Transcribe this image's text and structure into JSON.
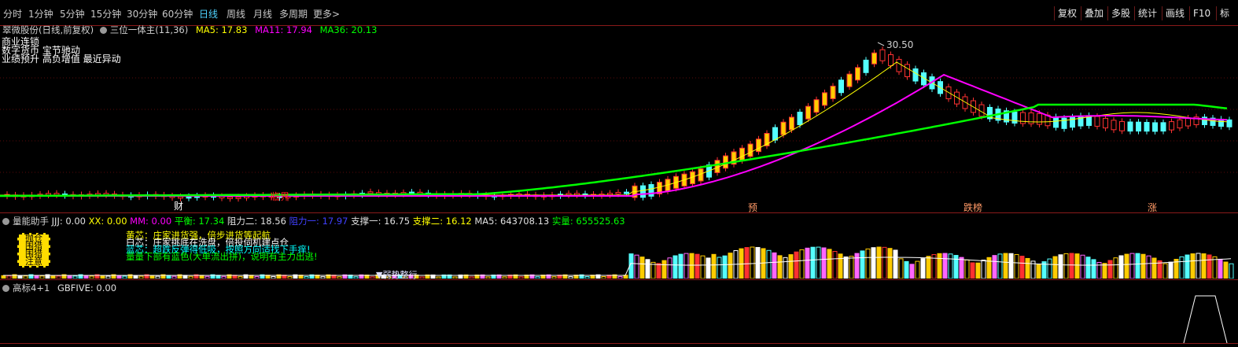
{
  "toolbar": {
    "periods": [
      "分时",
      "1分钟",
      "5分钟",
      "15分钟",
      "30分钟",
      "60分钟",
      "日线",
      "周线",
      "月线",
      "多周期",
      "更多"
    ],
    "active_period": "日线",
    "right_buttons": [
      "复权",
      "叠加",
      "多股",
      "统计",
      "画线",
      "F10",
      "标"
    ]
  },
  "main_panel": {
    "stock_title": "翠微股份(日线,前复权)",
    "indicator_name": "三位一体主(11,36)",
    "ma5": {
      "label": "MA5: 17.83",
      "color": "#ffff00"
    },
    "ma11": {
      "label": "MA11: 17.94",
      "color": "#ff00ff"
    },
    "ma36": {
      "label": "MA36: 20.13",
      "color": "#00ff00"
    },
    "concepts": [
      "商业连锁",
      "数字货币 宝节驰动",
      "业绩预升 高负增值 最近异动"
    ],
    "high_label": "30.50",
    "markers": [
      "财",
      "临界",
      "预",
      "跌榜",
      "涨"
    ]
  },
  "volume_panel": {
    "name": "量能助手",
    "stats": [
      {
        "text": "JJJ: 0.00",
        "color": "#e0e0e0"
      },
      {
        "text": "XX: 0.00",
        "color": "#ffff00"
      },
      {
        "text": "MM: 0.00",
        "color": "#ff00ff"
      },
      {
        "text": "平衡: 17.34",
        "color": "#00ff00"
      },
      {
        "text": "阻力二: 18.56",
        "color": "#e0e0e0"
      },
      {
        "text": "阻力一: 17.97",
        "color": "#4040ff"
      },
      {
        "text": "支撑一: 16.75",
        "color": "#e0e0e0"
      },
      {
        "text": "支撑二: 16.12",
        "color": "#ffff00"
      },
      {
        "text": "MA5: 643708.13",
        "color": "#e0e0e0"
      },
      {
        "text": "实量: 655525.63",
        "color": "#00ff00"
      }
    ],
    "legend_boxes": [
      "抛仓",
      "围猎",
      "围猎",
      "注意"
    ],
    "legend_lines": [
      {
        "text": "黄芯：庄家进货强，倍步进货等起航",
        "color": "#ffff00"
      },
      {
        "text": "白芯：庄家挑底在洗盘，倍投伺机建点仓",
        "color": "#ffffff"
      },
      {
        "text": "蓝芯：超跌反弹得低吸，按照方向适找下手痒!",
        "color": "#00ffff"
      },
      {
        "text": "量量下部有蓝色(大单流出拼)，说明有主力出逃!",
        "color": "#00ff00"
      }
    ],
    "weak_label": "▼弱势整行"
  },
  "bottom_panel": {
    "name": "高标4+1",
    "value": "GBFIVE: 0.00"
  },
  "colors": {
    "up": "#ff3232",
    "down": "#54ffff",
    "panel_border": "#8a1a1a",
    "yellow_candle": "#ffcc00"
  }
}
